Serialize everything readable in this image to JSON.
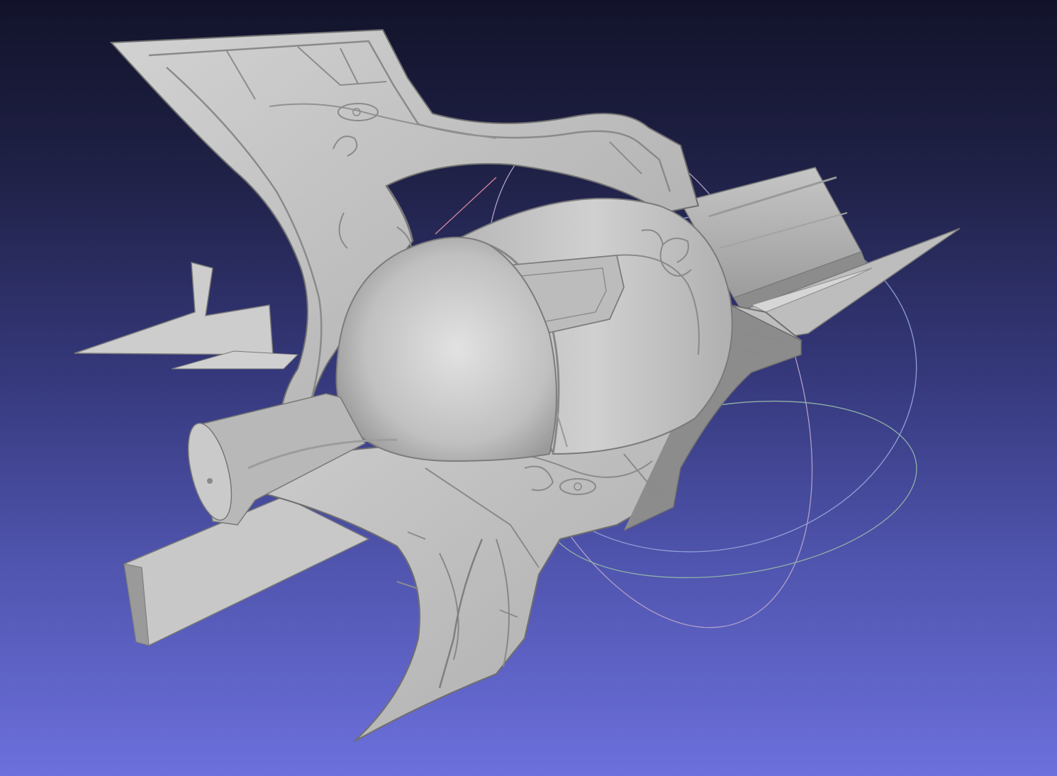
{
  "viewer": {
    "background_top": "#12132a",
    "background_bottom": "#6c70dc",
    "model_color": "#c4c4c4",
    "model_shadow": "#7d7d7d",
    "trackball_axes": {
      "x": "#d94a4a",
      "y": "#4cc84c",
      "z": "#5a7be0"
    }
  }
}
